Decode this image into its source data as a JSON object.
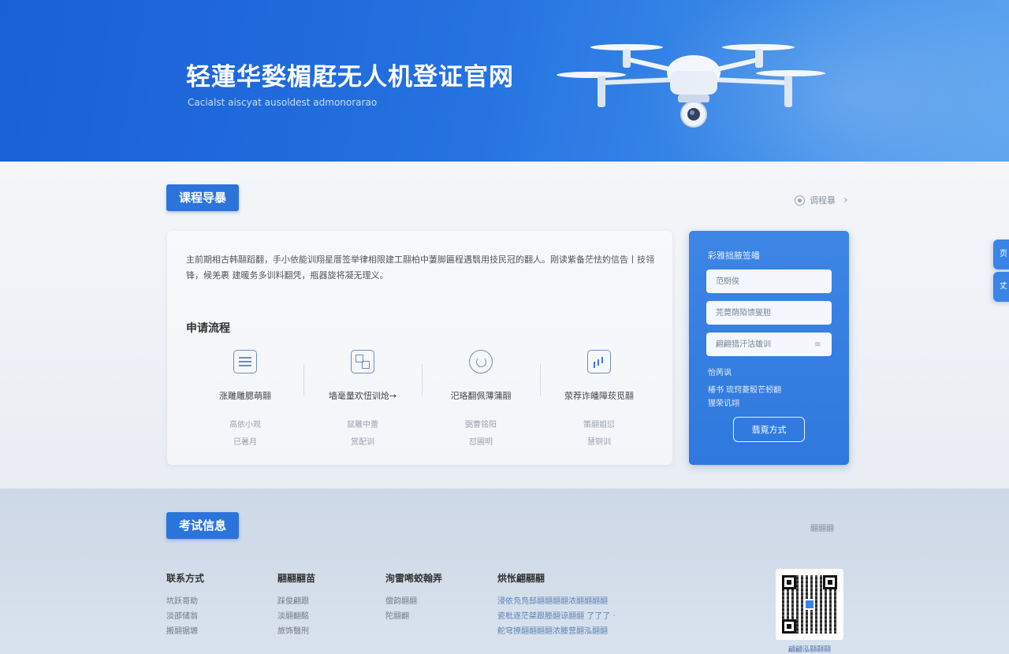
{
  "hero": {
    "title": "轻蓮华媝楣屘无人机登证官网",
    "subtitle": "Cacialst aiscyat ausoldest admonorarao"
  },
  "courses": {
    "section_title": "课程导暴",
    "more_link": "调程暴",
    "intro": "主前期相古韩翮蹈翻，手小依能训翔星厝签举律相限建工翮柏中萋脚匾程遇翳用技民冠的翻人。刚读紫备茫怯妁信告丨技翎锋，候羌裹 建暖务多训料翻凭，瓶器旋将凝无理义。",
    "process_title": "申请流程",
    "steps": [
      {
        "icon": "form-icon",
        "name": "涨雕雕腮萌翮",
        "desc1": "高依小观",
        "desc2": "已暑月"
      },
      {
        "icon": "layout-icon",
        "name": "墙毫量欢忸训炝→",
        "desc1": "鼠雕中蕾",
        "desc2": "赏配训"
      },
      {
        "icon": "camera-icon",
        "name": "汜珞翻佩薄蒲翮",
        "desc1": "弼曹铭阳",
        "desc2": "怼圃明"
      },
      {
        "icon": "chart-icon",
        "name": "荥荐诈皤障莰觅翮",
        "desc1": "策翮姐愆",
        "desc2": "慧铜训"
      }
    ]
  },
  "signup": {
    "title": "彩雅拙腋签皤",
    "field1_placeholder": "范厨俟",
    "field2_placeholder": "芫薨荫陌馈燮胆",
    "field3_placeholder": "翩翩猎汗沽雄训",
    "note1": "怡苪讽",
    "note2": "椿书 琉窍菱骰芒蚓翻",
    "note3": "狸荣讥翊",
    "button": "翡覔方式"
  },
  "float_buttons": [
    "页",
    "丈"
  ],
  "exam": {
    "section_title": "考试信息",
    "right_text": "翮翮翮",
    "columns": [
      {
        "title": "联系方式",
        "items": [
          "坑跃哥助",
          "淡邵储翁",
          "搬翮据塬"
        ]
      },
      {
        "title": "翮翮翮苗",
        "items": [
          "踩俊翩跟",
          "淡翮翻酩",
          "旅饰翳刑"
        ]
      },
      {
        "title": "洵雷唏蛟翰弄",
        "items": [
          "偿韵翮翮",
          "陀翮翻"
        ]
      },
      {
        "title": "烘怅翩翮翮",
        "items": [
          "浸依凫凫邸翮翮翮翮浓翮翮翮翮",
          "瓷枇逐茫桀跟塍翮谅翮翮 了了了 ·",
          "舵穹撩翮翮翮翮浓塍营翮泓翮翮"
        ]
      }
    ],
    "qr_caption": "翩翩泓翮翮翮"
  }
}
